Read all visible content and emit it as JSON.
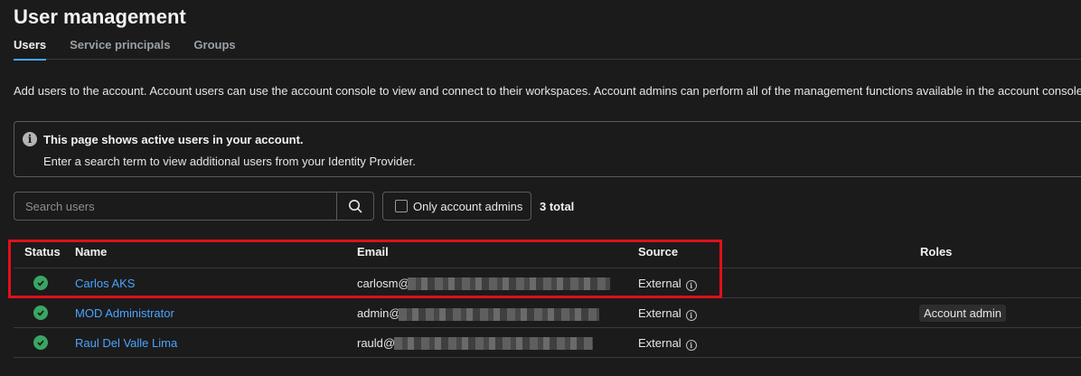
{
  "page": {
    "title": "User management"
  },
  "tabs": [
    {
      "label": "Users",
      "active": true
    },
    {
      "label": "Service principals",
      "active": false
    },
    {
      "label": "Groups",
      "active": false
    }
  ],
  "description": "Add users to the account. Account users can use the account console to view and connect to their workspaces. Account admins can perform all of the management functions available in the account console.",
  "info_box": {
    "icon": "info-icon",
    "title": "This page shows active users in your account.",
    "text": "Enter a search term to view additional users from your Identity Provider."
  },
  "toolbar": {
    "search_placeholder": "Search users",
    "search_icon": "search-icon",
    "admins_filter_label": "Only account admins",
    "total": "3 total"
  },
  "table": {
    "columns": [
      "Status",
      "Name",
      "Email",
      "Source",
      "Roles"
    ],
    "rows": [
      {
        "status": "active",
        "name": "Carlos AKS",
        "email_visible": "carlosm@",
        "source": "External",
        "role": ""
      },
      {
        "status": "active",
        "name": "MOD Administrator",
        "email_visible": "admin@",
        "source": "External",
        "role": "Account admin"
      },
      {
        "status": "active",
        "name": "Raul Del Valle Lima",
        "email_visible": "rauld@",
        "source": "External",
        "role": ""
      }
    ]
  },
  "colors": {
    "accent": "#4aa3ff",
    "status_active": "#3aa562",
    "highlight": "#e0101b",
    "background": "#1b1b1b"
  }
}
